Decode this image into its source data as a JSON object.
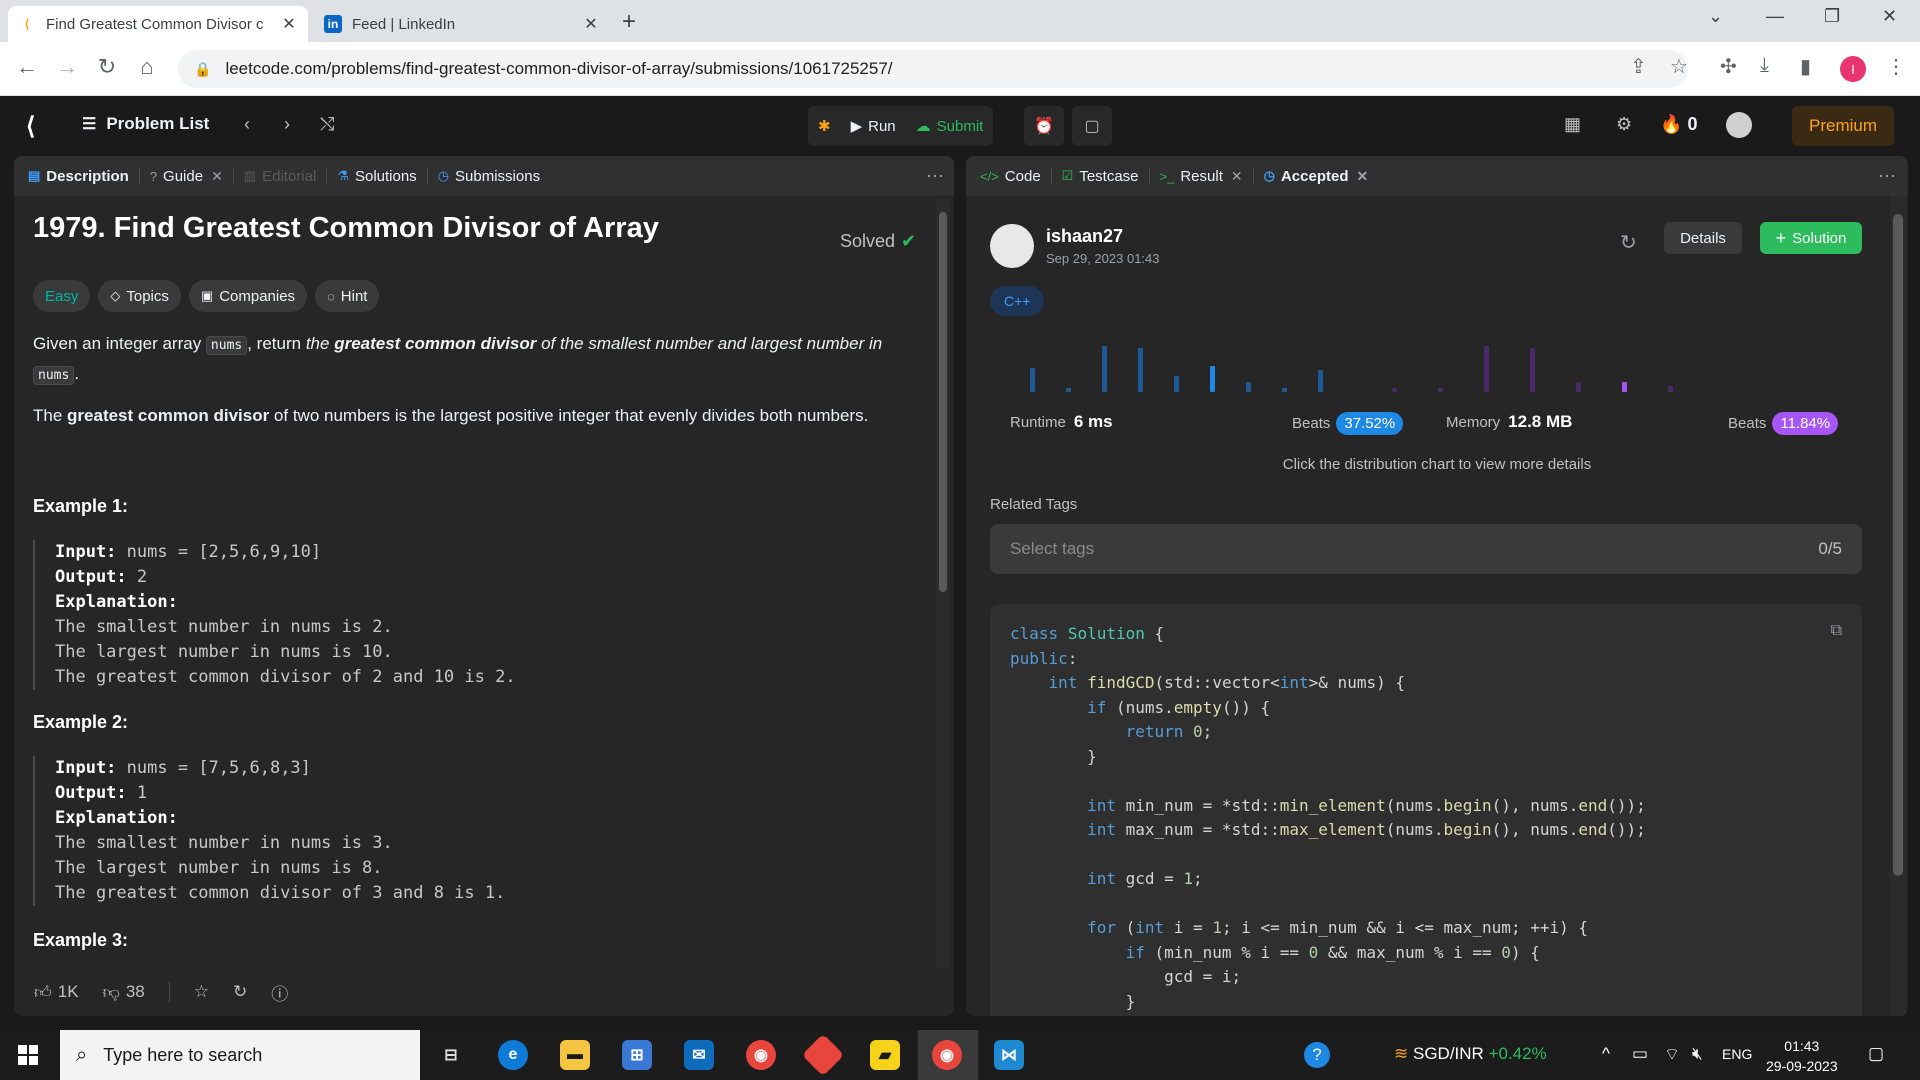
{
  "browser": {
    "tabs": [
      {
        "title": "Find Greatest Common Divisor c",
        "active": true
      },
      {
        "title": "Feed | LinkedIn",
        "active": false
      }
    ],
    "url": "leetcode.com/problems/find-greatest-common-divisor-of-array/submissions/1061725257/",
    "profile_initial": "I"
  },
  "navbar": {
    "problem_list": "Problem List",
    "run": "Run",
    "submit": "Submit",
    "streak": "0",
    "premium": "Premium"
  },
  "left_tabs": {
    "description": "Description",
    "guide": "Guide",
    "editorial": "Editorial",
    "solutions": "Solutions",
    "submissions": "Submissions"
  },
  "problem": {
    "title": "1979. Find Greatest Common Divisor of Array",
    "solved": "Solved",
    "difficulty": "Easy",
    "chips": [
      "Topics",
      "Companies",
      "Hint"
    ],
    "intro_a": "Given an integer array ",
    "nums": "nums",
    "intro_b": ", return ",
    "intro_c": "the ",
    "intro_bold": "greatest common divisor",
    "intro_d": " of the smallest number and largest number in",
    "intro_end": ".",
    "def_a": "The ",
    "def_bold": "greatest common divisor",
    "def_b": " of two numbers is the largest positive integer that evenly divides both numbers.",
    "examples": [
      {
        "heading": "Example 1:",
        "input": "nums = [2,5,6,9,10]",
        "output": "2",
        "explanation": [
          "The smallest number in nums is 2.",
          "The largest number in nums is 10.",
          "The greatest common divisor of 2 and 10 is 2."
        ]
      },
      {
        "heading": "Example 2:",
        "input": "nums = [7,5,6,8,3]",
        "output": "1",
        "explanation": [
          "The smallest number in nums is 3.",
          "The largest number in nums is 8.",
          "The greatest common divisor of 3 and 8 is 1."
        ]
      }
    ],
    "example3_heading": "Example 3:",
    "labels": {
      "input": "Input:",
      "output": "Output:",
      "explanation": "Explanation:"
    },
    "likes": "1K",
    "dislikes": "38"
  },
  "right_tabs": {
    "code": "Code",
    "testcase": "Testcase",
    "result": "Result",
    "accepted": "Accepted"
  },
  "submission": {
    "username": "ishaan27",
    "date": "Sep 29, 2023 01:43",
    "details": "Details",
    "solution": "Solution",
    "language": "C++",
    "runtime_label": "Runtime",
    "runtime_value": "6 ms",
    "runtime_beats_label": "Beats",
    "runtime_beats": "37.52%",
    "memory_label": "Memory",
    "memory_value": "12.8 MB",
    "memory_beats_label": "Beats",
    "memory_beats": "11.84%",
    "hint": "Click the distribution chart to view more details",
    "related_tags": "Related Tags",
    "select_tags": "Select tags",
    "tags_count": "0/5"
  },
  "colors": {
    "accent_green": "#2cbb5d",
    "runtime_blue": "#1e88e5",
    "memory_purple": "#a855f7",
    "premium_orange": "#ffa116",
    "easy_teal": "#00b8a3"
  },
  "taskbar": {
    "search_placeholder": "Type here to search",
    "currency": "SGD/INR",
    "currency_change": "+0.42%",
    "lang": "ENG",
    "time": "01:43",
    "date": "29-09-2023"
  }
}
